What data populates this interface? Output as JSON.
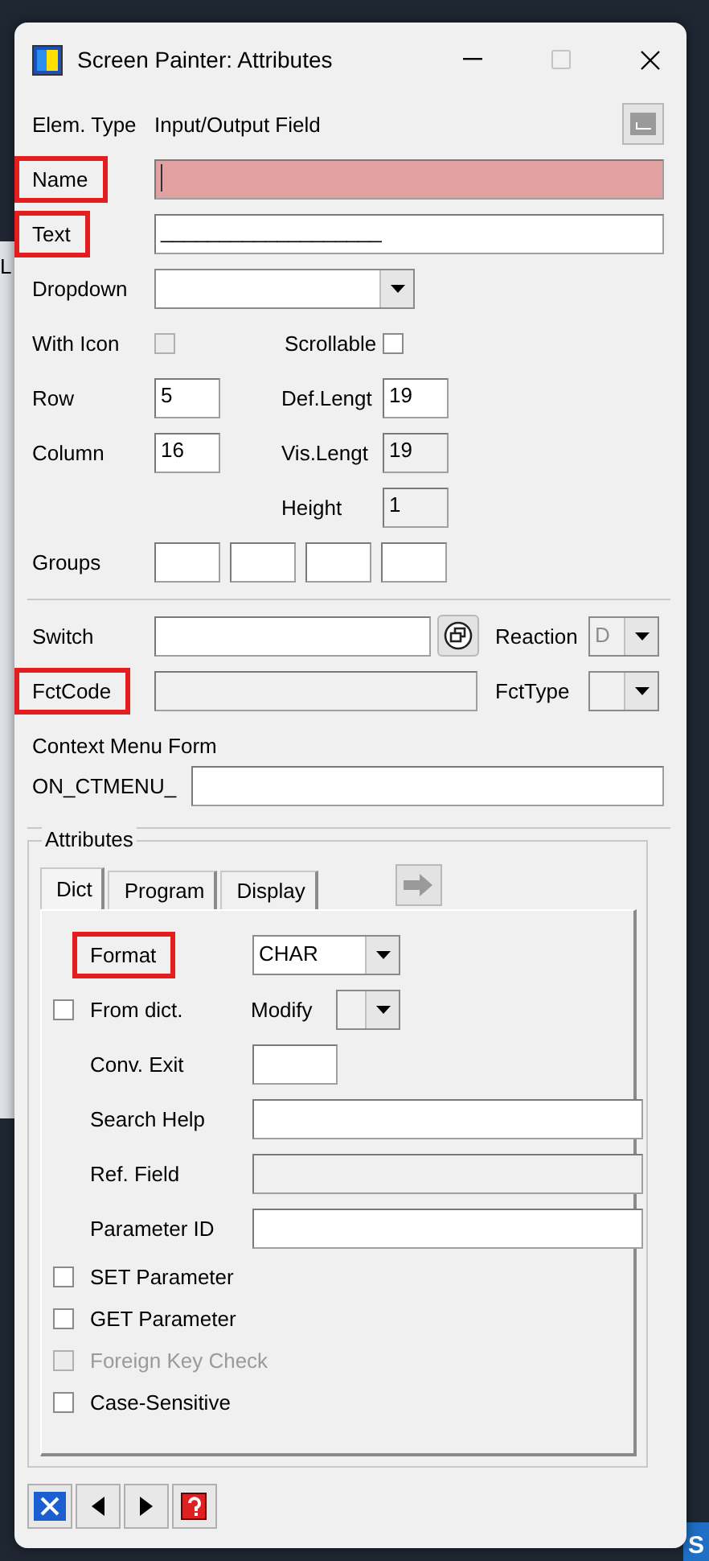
{
  "backdrop": {
    "left_letter": "L",
    "corner_tile": "S"
  },
  "window": {
    "title": "Screen Painter: Attributes",
    "maximize_disabled": true
  },
  "elem_type": {
    "label": "Elem. Type",
    "value": "Input/Output Field"
  },
  "name": {
    "label": "Name",
    "highlighted": true,
    "required": true
  },
  "text": {
    "label": "Text",
    "value": "___________________",
    "highlighted": true
  },
  "dropdown": {
    "label": "Dropdown"
  },
  "with_icon": {
    "label": "With Icon",
    "checked": false,
    "disabled": true
  },
  "scrollable": {
    "label": "Scrollable",
    "checked": false,
    "disabled": false
  },
  "row": {
    "label": "Row",
    "value": "5"
  },
  "def_length": {
    "label": "Def.Lengt",
    "value": "19"
  },
  "column": {
    "label": "Column",
    "value": "16"
  },
  "vis_length": {
    "label": "Vis.Lengt",
    "value": "19",
    "disabled": true
  },
  "height": {
    "label": "Height",
    "value": "1",
    "disabled": true
  },
  "groups": {
    "label": "Groups",
    "fields": [
      {
        "disabled": false
      },
      {
        "disabled": false
      },
      {
        "disabled": false
      },
      {
        "disabled": false
      }
    ]
  },
  "switch": {
    "label": "Switch"
  },
  "reaction": {
    "label": "Reaction",
    "value": "D",
    "disabled": true
  },
  "fct_code": {
    "label": "FctCode",
    "highlighted": true,
    "disabled": true
  },
  "fct_type": {
    "label": "FctType",
    "disabled": true
  },
  "context_menu": {
    "label": "Context Menu Form",
    "prefix": "ON_CTMENU_"
  },
  "attributes": {
    "title": "Attributes",
    "tabs": [
      {
        "label": "Dict",
        "selected": true
      },
      {
        "label": "Program",
        "selected": false
      },
      {
        "label": "Display",
        "selected": false
      }
    ],
    "rows": [
      {
        "kind": "combo",
        "label": "Format",
        "value": "CHAR",
        "highlighted": true
      },
      {
        "kind": "check_combo",
        "label": "From dict.",
        "checked": false,
        "combo_label": "Modify",
        "combo_disabled": true
      },
      {
        "kind": "short_field",
        "label": "Conv. Exit"
      },
      {
        "kind": "field",
        "label": "Search Help"
      },
      {
        "kind": "field",
        "label": "Ref. Field",
        "disabled": true
      },
      {
        "kind": "field",
        "label": "Parameter ID"
      },
      {
        "kind": "checkbox",
        "label": "SET Parameter",
        "checked": false,
        "disabled": false
      },
      {
        "kind": "checkbox",
        "label": "GET Parameter",
        "checked": false,
        "disabled": false
      },
      {
        "kind": "checkbox",
        "label": "Foreign Key Check",
        "checked": false,
        "disabled": true
      },
      {
        "kind": "checkbox",
        "label": "Case-Sensitive",
        "checked": false,
        "disabled": false
      }
    ]
  }
}
